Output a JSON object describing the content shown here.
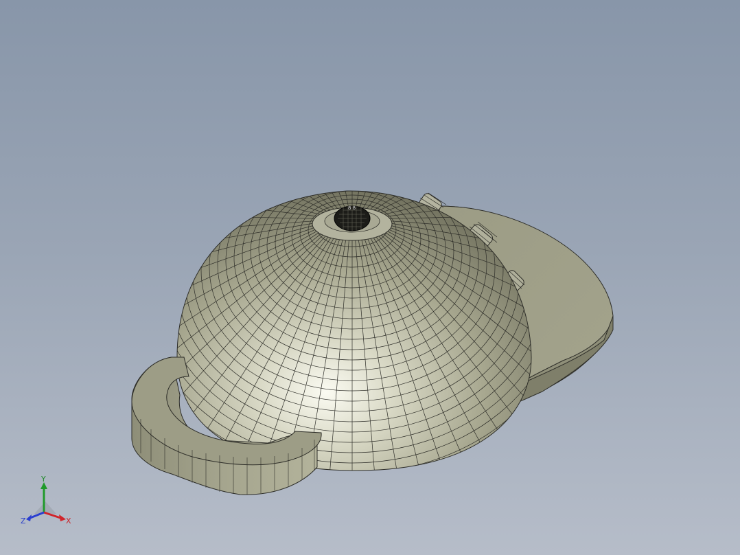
{
  "viewport": {
    "background_top": "#8896a9",
    "background_bottom": "#b6bdc9",
    "model_color": "#a9a990",
    "mesh_color": "#2d2d28"
  },
  "model": {
    "name_icon": "dome-with-handle-3d-model",
    "parts": [
      "dome",
      "base-plate",
      "handle",
      "top-nozzle",
      "side-knobs"
    ]
  },
  "triad": {
    "x_label": "X",
    "y_label": "Y",
    "z_label": "Z",
    "x_color": "#d0252b",
    "y_color": "#1f9a2a",
    "z_color": "#2a3fd0"
  }
}
